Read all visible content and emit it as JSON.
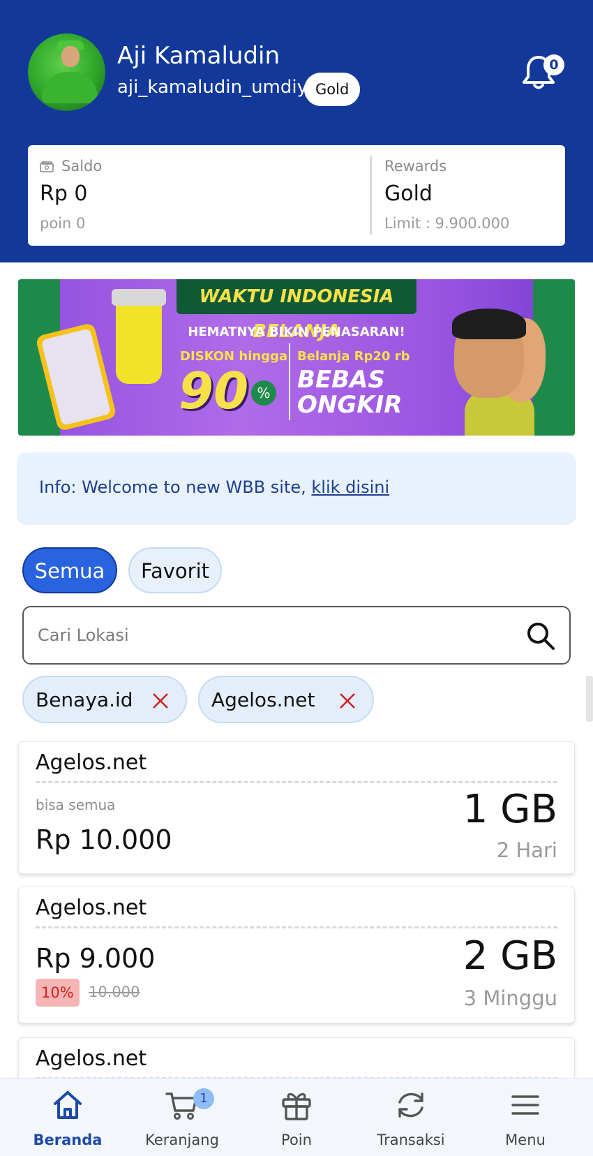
{
  "header": {
    "user_name": "Aji Kamaludin",
    "username": "aji_kamaludin_umdiy",
    "tier_badge": "Gold",
    "notification_count": "0",
    "bg_color": "#12399a"
  },
  "balance": {
    "saldo_label": "Saldo",
    "saldo_value": "Rp 0",
    "poin_value": "poin 0",
    "rewards_label": "Rewards",
    "rewards_value": "Gold",
    "limit_value": "Limit : 9.900.000"
  },
  "banner": {
    "title": "WAKTU INDONESIA BELANJA",
    "tagline": "HEMATNYA BIKIN PENASARAN!",
    "discount_label": "DISKON hingga",
    "discount_value": "90",
    "discount_unit": "%",
    "shop_label": "Belanja Rp20 rb",
    "shipping_value": "BEBAS ONGKIR"
  },
  "info": {
    "text": "Info: Welcome to new WBB site, ",
    "link": "klik disini"
  },
  "tabs": [
    {
      "label": "Semua",
      "active": true
    },
    {
      "label": "Favorit",
      "active": false
    }
  ],
  "search": {
    "placeholder": "Cari Lokasi"
  },
  "filters": [
    {
      "label": "Benaya.id"
    },
    {
      "label": "Agelos.net"
    }
  ],
  "products": [
    {
      "title": "Agelos.net",
      "desc": "bisa semua",
      "price": "Rp 10.000",
      "size": "1 GB",
      "duration": "2 Hari"
    },
    {
      "title": "Agelos.net",
      "price": "Rp 9.000",
      "discount": "10%",
      "original_price": "10.000",
      "size": "2 GB",
      "duration": "3 Minggu"
    },
    {
      "title": "Agelos.net"
    }
  ],
  "nav": {
    "items": [
      {
        "label": "Beranda",
        "icon": "home-icon",
        "active": true
      },
      {
        "label": "Keranjang",
        "icon": "cart-icon",
        "badge": "1"
      },
      {
        "label": "Poin",
        "icon": "gift-icon"
      },
      {
        "label": "Transaksi",
        "icon": "refresh-icon"
      },
      {
        "label": "Menu",
        "icon": "menu-icon"
      }
    ]
  },
  "colors": {
    "primary": "#12399a",
    "accent": "#2a63e0",
    "info_bg": "#e8f2fd",
    "danger": "#d42020"
  }
}
